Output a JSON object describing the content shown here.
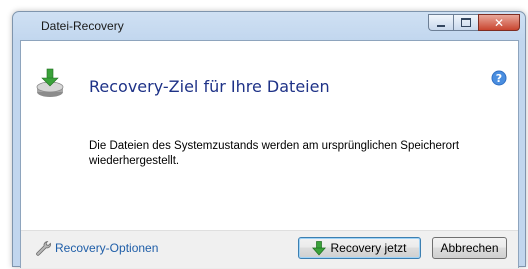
{
  "window": {
    "title": "Datei-Recovery"
  },
  "caption": {
    "minimize": "–",
    "maximize": "□",
    "close": "✕"
  },
  "header": {
    "title": "Recovery-Ziel für Ihre Dateien",
    "icon": "drive-download-icon",
    "help_icon": "help-icon"
  },
  "message": "Die Dateien des Systemzustands werden am ursprünglichen Speicherort wiederhergestellt.",
  "footer": {
    "options_label": "Recovery-Optionen",
    "options_icon": "wrench-icon",
    "recover_label": "Recovery jetzt",
    "recover_icon": "green-arrow-down-icon",
    "cancel_label": "Abbrechen"
  },
  "colors": {
    "heading": "#1e3287",
    "link": "#1f5ea8",
    "accent_green": "#2e9e2e"
  }
}
